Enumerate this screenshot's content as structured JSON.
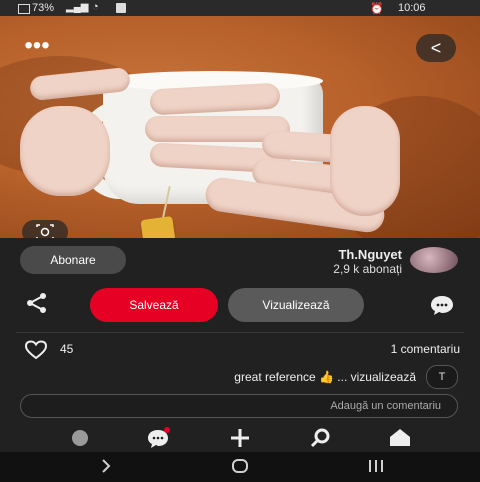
{
  "status_bar": {
    "time": "10:06",
    "battery": "73%"
  },
  "photo": {
    "menu_label": "•••",
    "back_label": "<"
  },
  "author": {
    "name": "Th.Nguyet",
    "subscribers": "2,9 k abonați",
    "subscribe_label": "Abonare"
  },
  "actions": {
    "visit_label": "Vizualizează",
    "save_label": "Salvează"
  },
  "stats": {
    "likes": "45",
    "comments": "1 comentariu"
  },
  "comment": {
    "avatar_letter": "T",
    "text": "great reference 👍 ... vizualizează"
  },
  "input": {
    "placeholder": "Adaugă un comentariu"
  },
  "colors": {
    "save": "#e60023",
    "panel": "#212121"
  },
  "icons": [
    "menu-dots-icon",
    "back-icon",
    "visual-search-icon",
    "share-icon",
    "comment-bubble-icon",
    "heart-icon",
    "home-icon",
    "search-icon",
    "add-icon",
    "messages-icon",
    "profile-icon"
  ]
}
